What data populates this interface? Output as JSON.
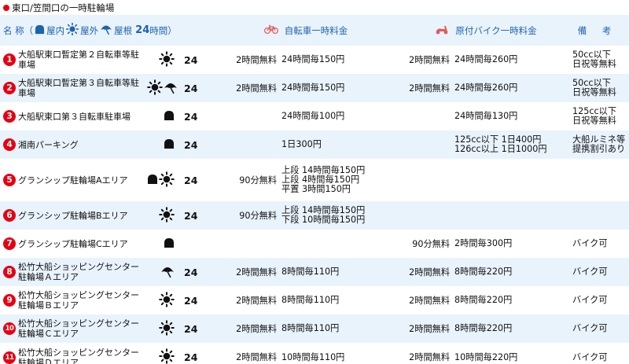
{
  "page_title": "東口/笠間口の一時駐輪場",
  "header": {
    "name_label": "名 称（",
    "indoor_label": "屋内",
    "outdoor_label": "屋外",
    "roof_label": "屋根",
    "hours_value": "24",
    "hours_unit": "時間）",
    "bicycle_label": "自転車一時料金",
    "moped_label": "原付バイク一時料金",
    "note_label": "備 考"
  },
  "colors": {
    "accent_red": "#e60012",
    "header_blue": "#1d63ad",
    "row_stripe": "#e9f3fc"
  },
  "rows": [
    {
      "num": "1",
      "name": "大船駅東口暫定第２自転車等駐車場",
      "icons": [
        "sun-icon"
      ],
      "hours": "24",
      "bike_free": "2時間無料",
      "bike_rate": [
        "24時間毎150円"
      ],
      "moto_free": "2時間無料",
      "moto_rate": [
        "24時間毎260円"
      ],
      "note": [
        "50cc以下",
        "日祝等無料"
      ]
    },
    {
      "num": "2",
      "name": "大船駅東口暫定第３自転車等駐車場",
      "icons": [
        "sun-icon",
        "umbrella-icon"
      ],
      "hours": "24",
      "bike_free": "2時間無料",
      "bike_rate": [
        "24時間毎150円"
      ],
      "moto_free": "2時間無料",
      "moto_rate": [
        "24時間毎260円"
      ],
      "note": [
        "50cc以下",
        "日祝等無料"
      ]
    },
    {
      "num": "3",
      "name": "大船駅東口第３自転車駐車場",
      "icons": [
        "indoor-icon"
      ],
      "hours": "24",
      "bike_free": "",
      "bike_rate": [
        "24時間毎100円"
      ],
      "moto_free": "",
      "moto_rate": [
        "24時間毎130円"
      ],
      "note": [
        "125cc以下",
        "日祝等無料"
      ]
    },
    {
      "num": "4",
      "name": "湘南パーキング",
      "icons": [
        "indoor-icon"
      ],
      "hours": "24",
      "bike_free": "",
      "bike_rate": [
        "1日300円"
      ],
      "moto_free": "",
      "moto_rate": [
        "125cc以下 1日400円",
        "126cc以上 1日1000円"
      ],
      "note": [
        "大船ルミネ等",
        "提携割引あり"
      ]
    },
    {
      "num": "5",
      "name": "グランシップ駐輪場Aエリア",
      "icons": [
        "indoor-icon",
        "sun-icon"
      ],
      "hours": "24",
      "bike_free": "90分無料",
      "bike_rate": [
        "上段 14時間毎150円",
        "上段 4時間毎150円",
        "平置 3時間150円"
      ],
      "moto_free": "",
      "moto_rate": [],
      "note": []
    },
    {
      "num": "6",
      "name": "グランシップ駐輪場Bエリア",
      "icons": [
        "sun-icon"
      ],
      "hours": "24",
      "bike_free": "90分無料",
      "bike_rate": [
        "上段 14時間毎150円",
        "下段 10時間毎150円"
      ],
      "moto_free": "",
      "moto_rate": [],
      "note": []
    },
    {
      "num": "7",
      "name": "グランシップ駐輪場Cエリア",
      "icons": [
        "indoor-icon"
      ],
      "hours": "",
      "bike_free": "",
      "bike_rate": [],
      "moto_free": "90分無料",
      "moto_rate": [
        "2時間毎300円"
      ],
      "note": [
        "バイク可"
      ]
    },
    {
      "num": "8",
      "name": "松竹大船ショッピングセンター駐輪場Ａエリア",
      "icons": [
        "umbrella-icon"
      ],
      "hours": "24",
      "bike_free": "2時間無料",
      "bike_rate": [
        "8時間毎110円"
      ],
      "moto_free": "2時間無料",
      "moto_rate": [
        "8時間毎220円"
      ],
      "note": [
        "バイク可"
      ]
    },
    {
      "num": "9",
      "name": "松竹大船ショッピングセンター駐輪場Ｂエリア",
      "icons": [
        "sun-icon"
      ],
      "hours": "24",
      "bike_free": "2時間無料",
      "bike_rate": [
        "8時間毎110円"
      ],
      "moto_free": "2時間無料",
      "moto_rate": [
        "8時間毎220円"
      ],
      "note": [
        "バイク可"
      ]
    },
    {
      "num": "10",
      "name": "松竹大船ショッピングセンター駐輪場Ｃエリア",
      "icons": [
        "sun-icon"
      ],
      "hours": "24",
      "bike_free": "2時間無料",
      "bike_rate": [
        "8時間毎110円"
      ],
      "moto_free": "2時間無料",
      "moto_rate": [
        "8時間毎220円"
      ],
      "note": [
        "バイク可"
      ]
    },
    {
      "num": "11",
      "name": "松竹大船ショッピングセンター駐輪場Ｄエリア",
      "icons": [
        "sun-icon"
      ],
      "hours": "24",
      "bike_free": "2時間無料",
      "bike_rate": [
        "10時間毎110円"
      ],
      "moto_free": "2時間無料",
      "moto_rate": [
        "10時間毎220円"
      ],
      "note": [
        "バイク可"
      ]
    }
  ]
}
